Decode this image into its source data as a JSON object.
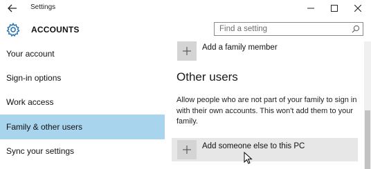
{
  "window": {
    "title": "Settings",
    "icons": {
      "back": "back-arrow-icon",
      "minimize": "minimize-icon",
      "maximize": "maximize-icon",
      "close": "close-icon"
    }
  },
  "header": {
    "section_title": "ACCOUNTS",
    "section_icon": "gear-icon",
    "search": {
      "placeholder": "Find a setting",
      "icon": "search-icon"
    }
  },
  "sidebar": {
    "items": [
      {
        "label": "Your account",
        "active": false
      },
      {
        "label": "Sign-in options",
        "active": false
      },
      {
        "label": "Work access",
        "active": false
      },
      {
        "label": "Family & other users",
        "active": true
      },
      {
        "label": "Sync your settings",
        "active": false
      }
    ]
  },
  "content": {
    "add_family_label": "Add a family member",
    "other_users_heading": "Other users",
    "other_users_description": "Allow people who are not part of your family to sign in with their own accounts. This won't add them to your family.",
    "add_someone_label": "Add someone else to this PC"
  },
  "colors": {
    "accent": "#0078d7",
    "selected_nav": "#a8d4ee",
    "hover_row": "#e7e7e7",
    "plus_box": "#d4d4d4"
  }
}
